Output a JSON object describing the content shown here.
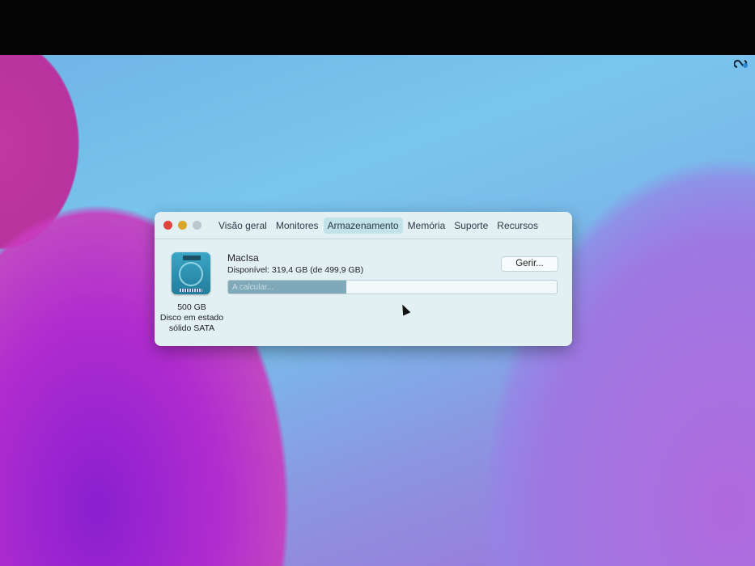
{
  "window": {
    "tabs": [
      {
        "label": "Visão geral",
        "active": false
      },
      {
        "label": "Monitores",
        "active": false
      },
      {
        "label": "Armazenamento",
        "active": true
      },
      {
        "label": "Memória",
        "active": false
      },
      {
        "label": "Suporte",
        "active": false
      },
      {
        "label": "Recursos",
        "active": false
      }
    ],
    "disk": {
      "capacity": "500 GB",
      "type_line1": "Disco em estado",
      "type_line2": "sólido SATA",
      "name": "MacIsa",
      "available": "Disponível: 319,4 GB (de 499,9 GB)",
      "status": "A calcular...",
      "used_percent": 36
    },
    "manage_label": "Gerir..."
  },
  "colors": {
    "close": "#e0443e",
    "minimize": "#d9a62a",
    "zoom": "#b9c8cc",
    "accent": "#c2e2ea"
  }
}
